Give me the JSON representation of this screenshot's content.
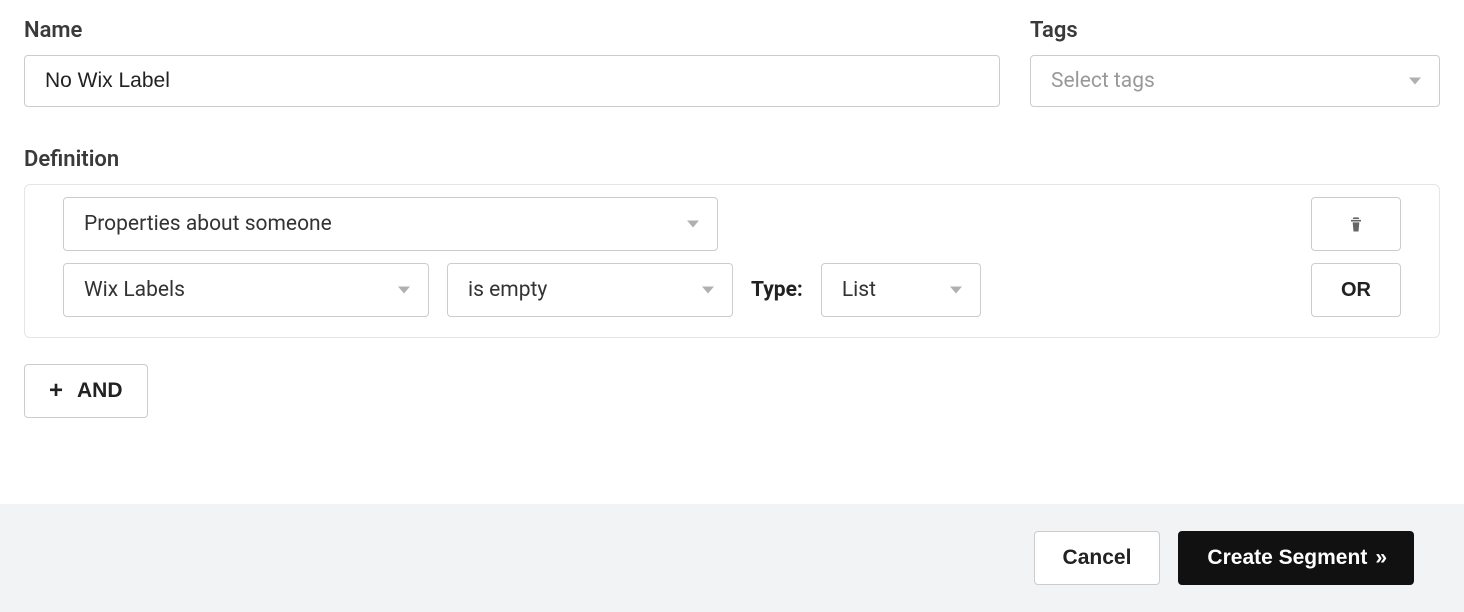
{
  "labels": {
    "name": "Name",
    "tags": "Tags",
    "definition": "Definition",
    "type": "Type:"
  },
  "name_value": "No Wix Label",
  "tags_placeholder": "Select tags",
  "definition": {
    "property_source": "Properties about someone",
    "field": "Wix Labels",
    "operator": "is empty",
    "type_value": "List"
  },
  "buttons": {
    "or": "OR",
    "and": "AND",
    "cancel": "Cancel",
    "create": "Create Segment",
    "create_arrows": "»"
  }
}
